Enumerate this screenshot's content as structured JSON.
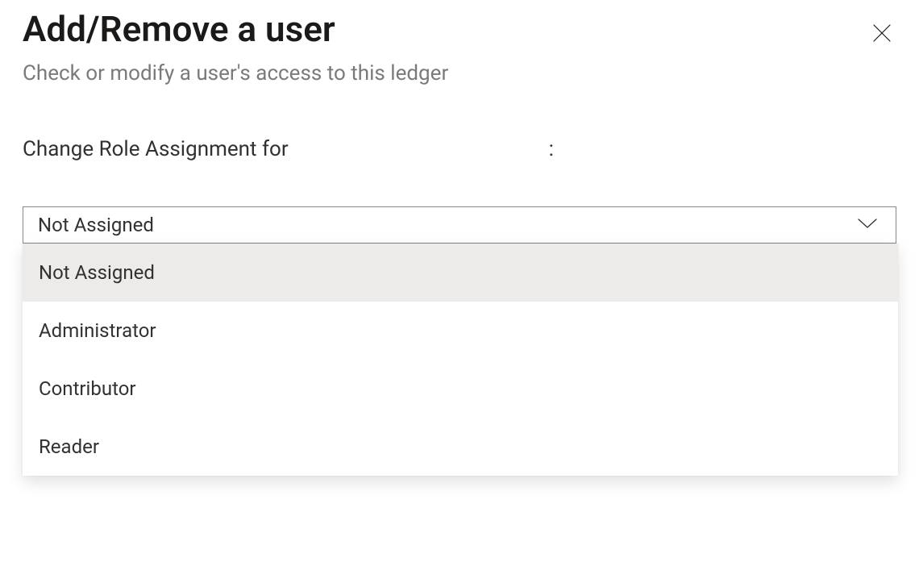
{
  "header": {
    "title": "Add/Remove a user",
    "subtitle": "Check or modify a user's access to this ledger"
  },
  "form": {
    "label_prefix": "Change Role Assignment for",
    "user_name": "",
    "label_suffix": ":"
  },
  "dropdown": {
    "selected": "Not Assigned",
    "options": [
      {
        "label": "Not Assigned",
        "selected": true
      },
      {
        "label": "Administrator",
        "selected": false
      },
      {
        "label": "Contributor",
        "selected": false
      },
      {
        "label": "Reader",
        "selected": false
      }
    ]
  }
}
